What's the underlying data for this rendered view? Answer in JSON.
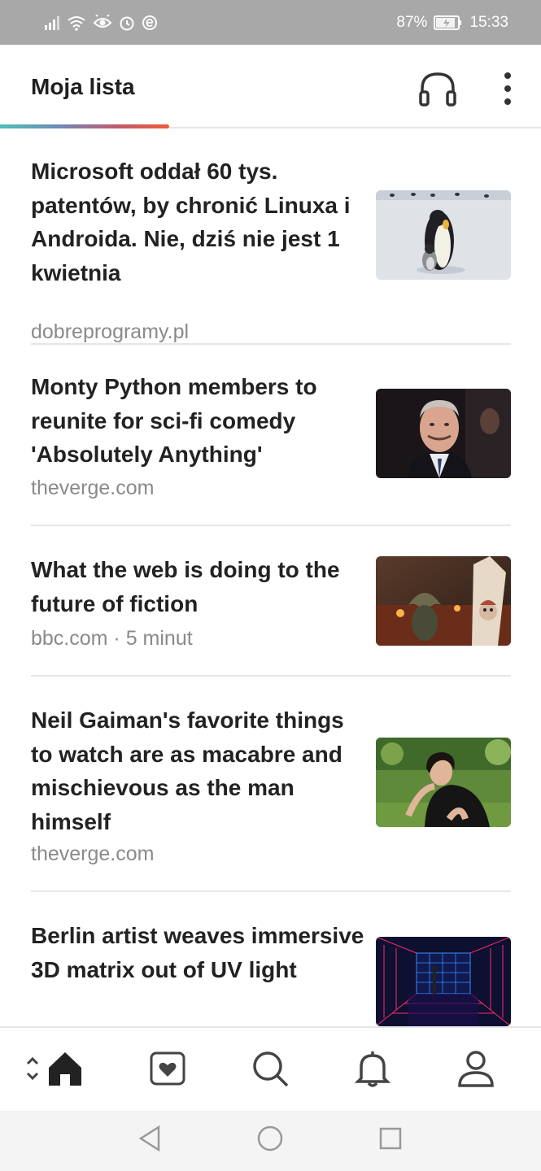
{
  "status_bar": {
    "battery_percent": "87%",
    "time": "15:33",
    "icons": [
      "signal-icon",
      "wifi-icon",
      "eye-icon",
      "alarm-icon",
      "e-icon",
      "battery-icon"
    ]
  },
  "header": {
    "title": "Moja lista",
    "actions": [
      "headphones-icon",
      "more-vertical-icon"
    ]
  },
  "colors": {
    "accent_gradient": [
      "#4fbfb4",
      "#6f8ab8",
      "#c25a6a",
      "#ef5a3c"
    ],
    "text_primary": "#222222",
    "text_secondary": "#8a8a8a"
  },
  "articles": [
    {
      "title": "Microsoft oddał 60 tys. patentów, by chronić Linuxa i Androida. Nie, dziś nie jest 1 kwietnia",
      "meta": "dobreprogramy.pl",
      "thumbnail": "penguins-thumbnail"
    },
    {
      "title": "Monty Python members to reunite for sci-fi comedy 'Absolutely Anything'",
      "meta": "theverge.com",
      "thumbnail": "portrait-thumbnail"
    },
    {
      "title": "What the web is doing to the future of fiction",
      "meta": "bbc.com · 5 minut",
      "thumbnail": "fantasy-scene-thumbnail"
    },
    {
      "title": "Neil Gaiman's favorite things to watch are as macabre and mischievous as the man himself",
      "meta": "theverge.com",
      "thumbnail": "man-in-grass-thumbnail"
    },
    {
      "title": "Berlin artist weaves immersive 3D matrix out of UV light",
      "meta": "",
      "thumbnail": "uv-light-room-thumbnail"
    }
  ],
  "bottom_nav": {
    "items": [
      "home-icon",
      "saved-heart-icon",
      "search-icon",
      "bell-icon",
      "profile-icon"
    ],
    "active": "home-icon"
  },
  "system_nav": {
    "items": [
      "back-icon",
      "home-circle-icon",
      "recents-icon"
    ]
  }
}
